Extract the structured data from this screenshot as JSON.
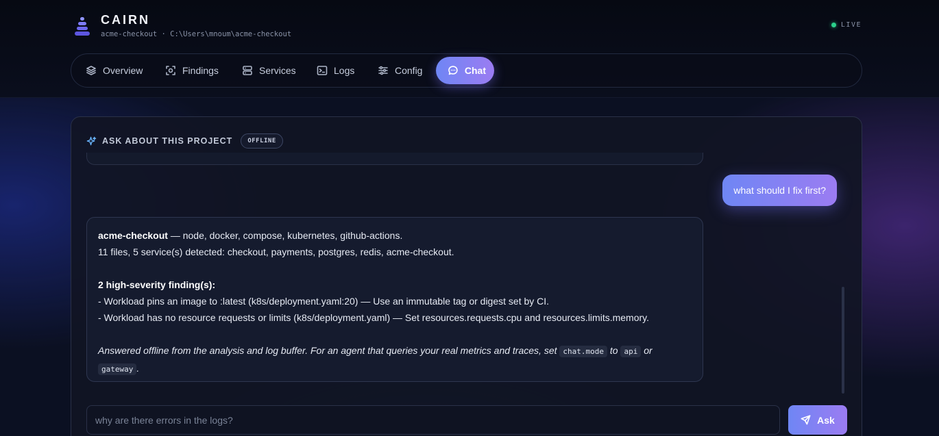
{
  "app": {
    "brand": "CAIRN",
    "subtitle": "acme-checkout · C:\\Users\\mnoum\\acme-checkout",
    "status": "LIVE",
    "status_color": "#2bd18b",
    "accent_gradient": [
      "#6f86f4",
      "#9b7cf2"
    ]
  },
  "nav": {
    "tabs": [
      {
        "label": "Overview",
        "icon": "layers-icon",
        "active": false
      },
      {
        "label": "Findings",
        "icon": "scan-icon",
        "active": false
      },
      {
        "label": "Services",
        "icon": "server-icon",
        "active": false
      },
      {
        "label": "Logs",
        "icon": "terminal-icon",
        "active": false
      },
      {
        "label": "Config",
        "icon": "sliders-icon",
        "active": false
      },
      {
        "label": "Chat",
        "icon": "chat-bubble-icon",
        "active": true
      }
    ]
  },
  "chat": {
    "title": "ASK ABOUT THIS PROJECT",
    "mode_badge": "OFFLINE",
    "user_message": "what should I fix first?",
    "answer": {
      "project_name": "acme-checkout",
      "stack_suffix": " — node, docker, compose, kubernetes, github-actions.",
      "summary": "11 files, 5 service(s) detected: checkout, payments, postgres, redis, acme-checkout.",
      "findings_heading": "2 high-severity finding(s):",
      "findings": [
        "- Workload pins an image to :latest (k8s/deployment.yaml:20) — Use an immutable tag or digest set by CI.",
        "- Workload has no resource requests or limits (k8s/deployment.yaml) — Set resources.requests.cpu and resources.limits.memory."
      ],
      "note_prefix": "Answered offline from the analysis and log buffer. For an agent that queries your real metrics and traces, set ",
      "note_code_1": "chat.mode",
      "note_to": " to ",
      "note_code_2": "api",
      "note_or": " or",
      "note_code_3": "gateway",
      "note_end": "."
    },
    "input_placeholder": "why are there errors in the logs?",
    "ask_label": "Ask"
  }
}
